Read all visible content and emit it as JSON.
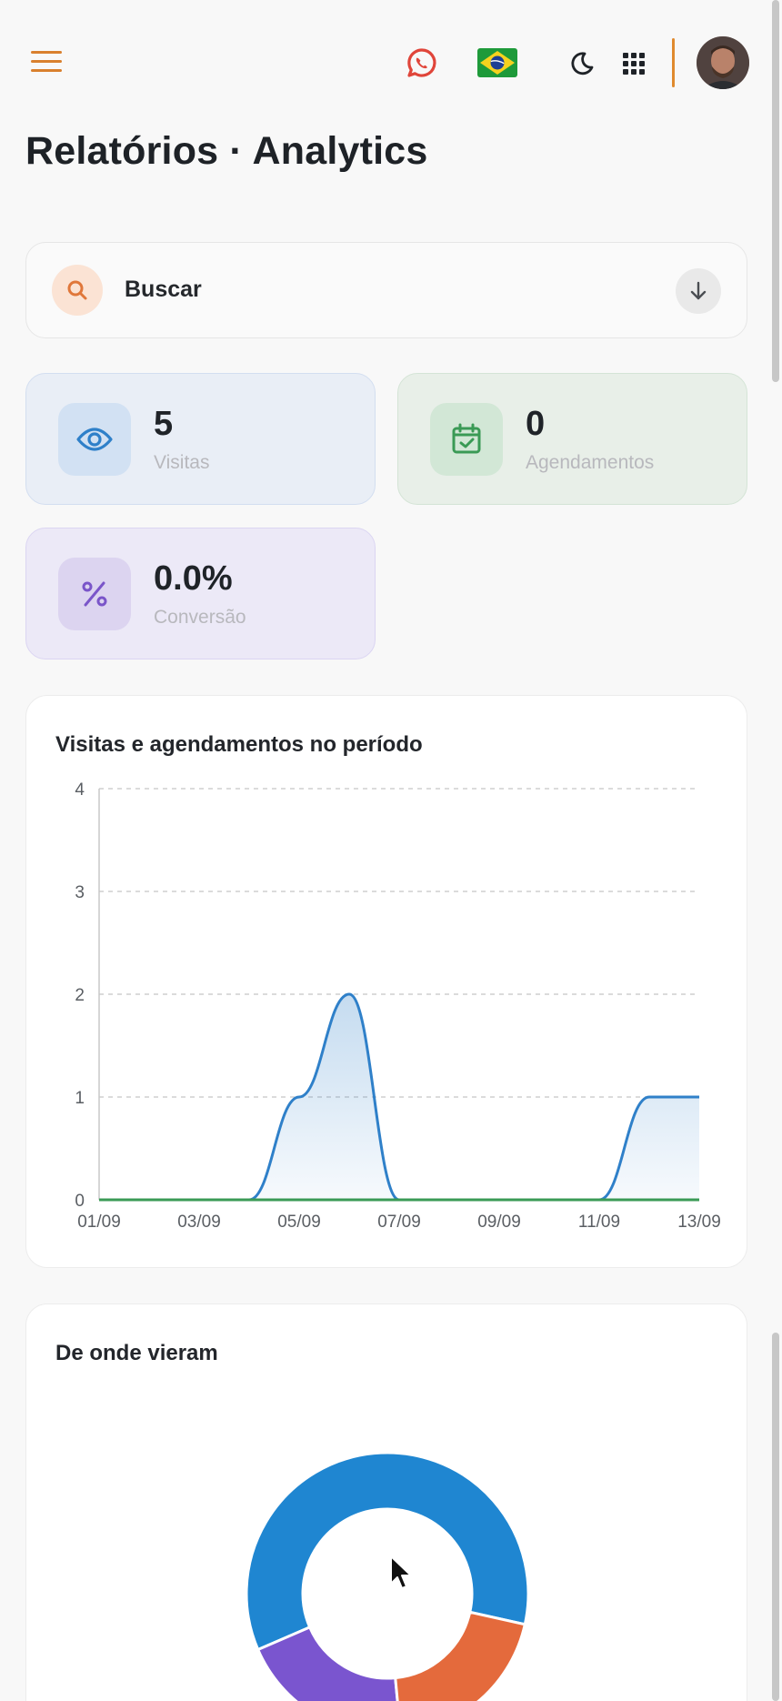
{
  "header": {
    "icons": [
      "menu-icon",
      "whatsapp-icon",
      "brazil-flag-icon",
      "moon-icon",
      "apps-grid-icon",
      "avatar"
    ]
  },
  "page": {
    "title": "Relatórios · Analytics"
  },
  "search": {
    "label": "Buscar"
  },
  "stats": [
    {
      "value": "5",
      "label": "Visitas",
      "color": "#2f80c9"
    },
    {
      "value": "0",
      "label": "Agendamentos",
      "color": "#3a9a55"
    },
    {
      "value": "0.0%",
      "label": "Conversão",
      "color": "#7a55c9"
    }
  ],
  "chart_data": [
    {
      "type": "area",
      "title": "Visitas e agendamentos no período",
      "x": [
        "01/09",
        "02/09",
        "03/09",
        "04/09",
        "05/09",
        "06/09",
        "07/09",
        "08/09",
        "09/09",
        "10/09",
        "11/09",
        "12/09",
        "13/09"
      ],
      "x_tick_labels": [
        "01/09",
        "03/09",
        "05/09",
        "07/09",
        "09/09",
        "11/09",
        "13/09"
      ],
      "ylim": [
        0,
        4
      ],
      "y_ticks": [
        0,
        1,
        2,
        3,
        4
      ],
      "grid": true,
      "series": [
        {
          "name": "",
          "color": "#2f80c9",
          "values": [
            0,
            0,
            0,
            0,
            1,
            2,
            0,
            0,
            0,
            0,
            0,
            1,
            1
          ]
        },
        {
          "name": "",
          "color": "#3a9a55",
          "values": [
            0,
            0,
            0,
            0,
            0,
            0,
            0,
            0,
            0,
            0,
            0,
            0,
            0
          ]
        }
      ]
    },
    {
      "type": "pie",
      "title": "De onde vieram",
      "donut": true,
      "slices": [
        {
          "value": 60,
          "color": "#1f86d1"
        },
        {
          "value": 20,
          "color": "#7a55cf"
        },
        {
          "value": 20,
          "color": "#e46a3c"
        }
      ]
    }
  ]
}
